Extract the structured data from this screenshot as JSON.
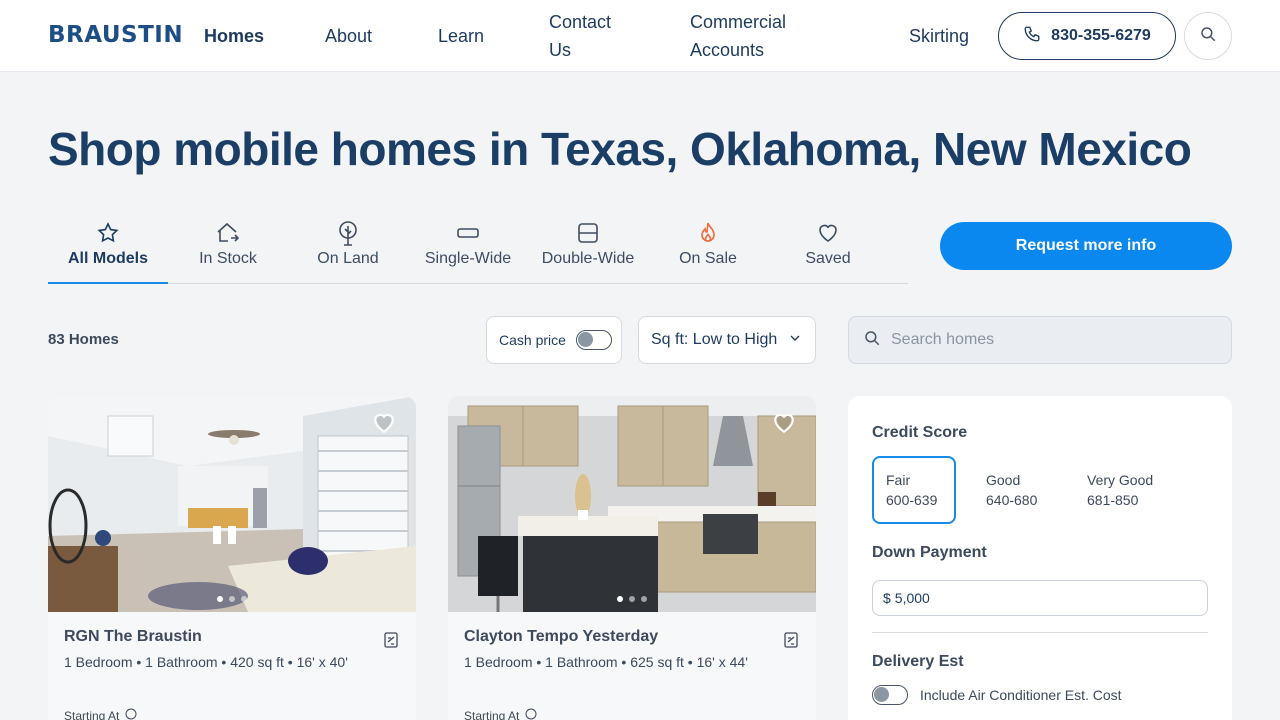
{
  "header": {
    "logo": "BRAUSTIN",
    "nav": [
      "Homes",
      "About",
      "Learn",
      "Contact Us",
      "Commercial Accounts",
      "Skirting"
    ],
    "phone": "830-355-6279"
  },
  "page_title": "Shop mobile homes in Texas, Oklahoma, New Mexico",
  "tabs": [
    {
      "label": "All Models",
      "icon": "star-icon"
    },
    {
      "label": "In Stock",
      "icon": "home-arrow-icon"
    },
    {
      "label": "On Land",
      "icon": "tree-icon"
    },
    {
      "label": "Single-Wide",
      "icon": "single-wide-icon"
    },
    {
      "label": "Double-Wide",
      "icon": "double-wide-icon"
    },
    {
      "label": "On Sale",
      "icon": "flame-icon"
    },
    {
      "label": "Saved",
      "icon": "heart-icon"
    }
  ],
  "request_button": "Request more info",
  "toolbar": {
    "count": "83 Homes",
    "cash_label": "Cash price",
    "sort_value": "Sq ft: Low to High",
    "search_placeholder": "Search homes"
  },
  "cards": [
    {
      "name": "RGN The Braustin",
      "specs": "1 Bedroom • 1 Bathroom • 420 sq ft • 16' x 40'",
      "starting": "Starting At"
    },
    {
      "name": "Clayton Tempo Yesterday",
      "specs": "1 Bedroom • 1 Bathroom • 625 sq ft • 16' x 44'",
      "starting": "Starting At"
    }
  ],
  "panel": {
    "credit_title": "Credit Score",
    "credit_options": [
      {
        "name": "Fair",
        "range": "600-639"
      },
      {
        "name": "Good",
        "range": "640-680"
      },
      {
        "name": "Very Good",
        "range": "681-850"
      }
    ],
    "down_title": "Down Payment",
    "down_currency": "$",
    "down_value": "5,000",
    "delivery_title": "Delivery Est",
    "ac_label": "Include Air Conditioner Est. Cost"
  },
  "colors": {
    "accent": "#0a88ef",
    "navy": "#1d3a5f",
    "flame": "#f26b3a"
  }
}
